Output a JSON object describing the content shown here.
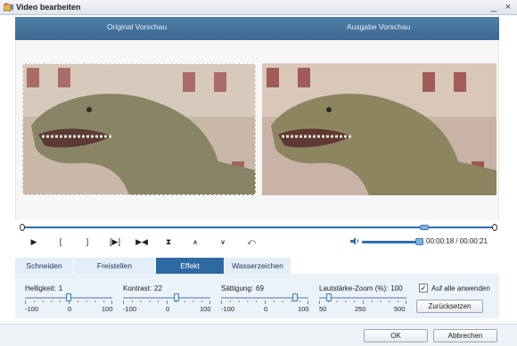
{
  "window": {
    "title": "Video bearbeiten",
    "minimize": "_",
    "close": "×"
  },
  "preview": {
    "original_label": "Original Vorschau",
    "output_label": "Ausgabe Vorschau"
  },
  "playback": {
    "play": "▶",
    "mark_in": "[",
    "mark_out": "]",
    "play_segment": "[▶]",
    "next": "▶◀",
    "split": "⧗",
    "flip_v": "⩚",
    "flip_h": "⩛",
    "rotate": "⤺",
    "time": "00:00:18 / 00:00:21",
    "progress": 0.857,
    "volume": 1.0
  },
  "tabs": [
    {
      "label": "Schneiden",
      "active": false
    },
    {
      "label": "Freistellen",
      "active": false
    },
    {
      "label": "Effekt",
      "active": true
    },
    {
      "label": "Wasserzeichen",
      "active": false
    }
  ],
  "effects": {
    "brightness": {
      "label": "Helligkeit:",
      "value": "1",
      "min": "-100",
      "mid": "0",
      "max": "100",
      "level": 1
    },
    "contrast": {
      "label": "Kontrast:",
      "value": "22",
      "min": "-100",
      "mid": "0",
      "max": "100",
      "level": 22
    },
    "saturation": {
      "label": "Sättigung:",
      "value": "69",
      "min": "-100",
      "mid": "0",
      "max": "100",
      "level": 69
    },
    "volume_zoom": {
      "label": "Lautstärke-Zoom (%):",
      "value": "100",
      "min": "50",
      "mid": "250",
      "max": "500",
      "level": 100
    },
    "apply_all": {
      "label": "Auf alle anwenden",
      "checked": true,
      "mark": "✓"
    },
    "reset": "Zurücksetzen"
  },
  "footer": {
    "ok": "OK",
    "cancel": "Abbrechen"
  },
  "colors": {
    "header": "#3f6c96",
    "active_tab": "#2d6aa3",
    "accent": "#2f6fb0"
  }
}
